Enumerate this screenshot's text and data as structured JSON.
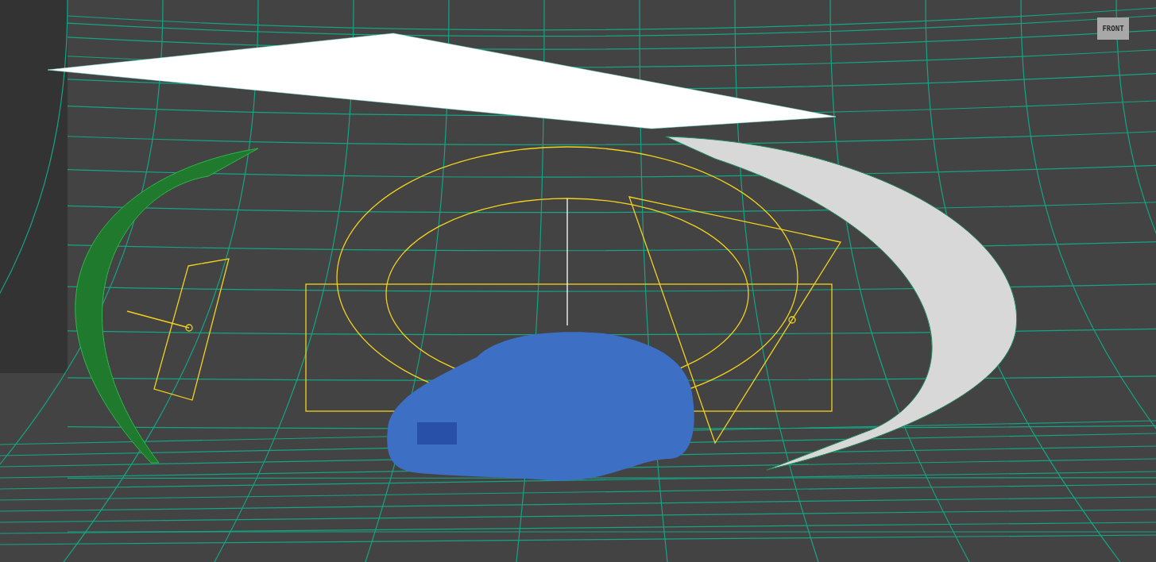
{
  "viewport": {
    "viewcube": {
      "face_label": "FRONT"
    }
  }
}
